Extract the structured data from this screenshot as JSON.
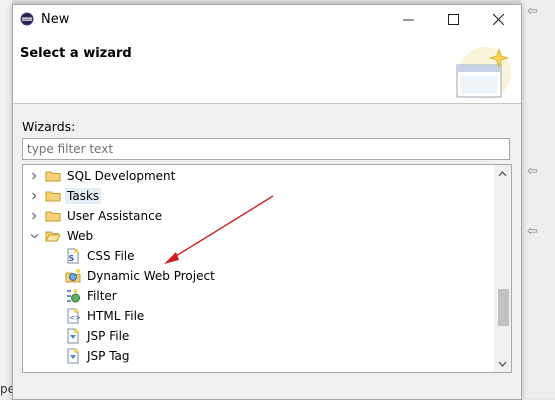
{
  "background": {
    "left_edge_text": "pe"
  },
  "dialog": {
    "title": "New",
    "header_title": "Select a wizard",
    "wizards_label": "Wizards:",
    "filter_placeholder": "type filter text",
    "tree": [
      {
        "label": "SQL Development",
        "expanded": false,
        "icon": "folder-icon"
      },
      {
        "label": "Tasks",
        "expanded": false,
        "icon": "folder-icon",
        "selected": true
      },
      {
        "label": "User Assistance",
        "expanded": false,
        "icon": "folder-icon"
      },
      {
        "label": "Web",
        "expanded": true,
        "icon": "folder-open-icon",
        "children": [
          {
            "label": "CSS File",
            "icon": "css-file-icon"
          },
          {
            "label": "Dynamic Web Project",
            "icon": "web-project-icon"
          },
          {
            "label": "Filter",
            "icon": "filter-icon"
          },
          {
            "label": "HTML File",
            "icon": "html-file-icon"
          },
          {
            "label": "JSP File",
            "icon": "jsp-file-icon"
          },
          {
            "label": "JSP Tag",
            "icon": "jsp-tag-icon"
          }
        ]
      }
    ]
  },
  "colors": {
    "annotation_arrow": "#cc1f1f",
    "selection": "#e5eef7",
    "folder": "#e8b84a"
  }
}
